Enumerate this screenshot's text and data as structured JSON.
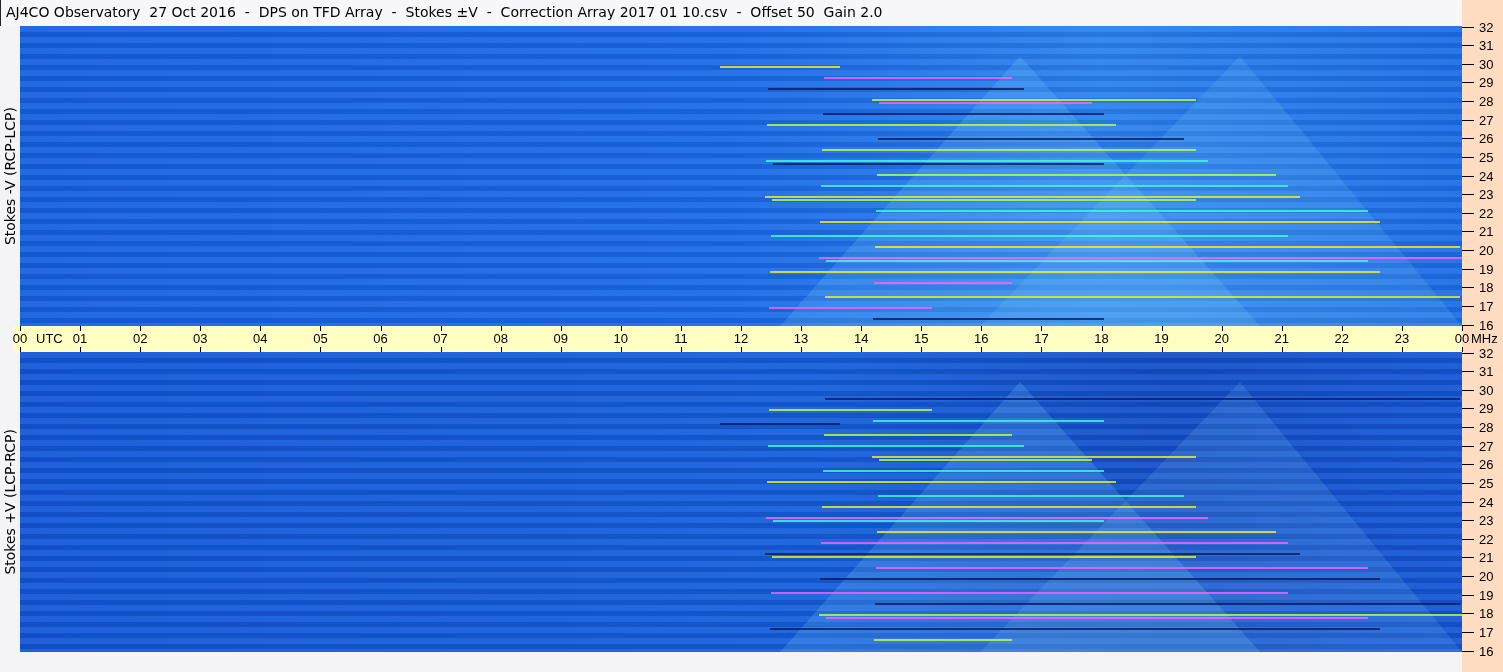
{
  "title": "AJ4CO Observatory  27 Oct 2016  -  DPS on TFD Array  -  Stokes ±V  -  Correction Array 2017 01 10.csv  -  Offset 50  Gain 2.0",
  "panels": [
    {
      "label": "Stokes -V (RCP-LCP)",
      "frequency_ticks": [
        "32",
        "31",
        "30",
        "29",
        "28",
        "27",
        "26",
        "25",
        "24",
        "23",
        "22",
        "21",
        "20",
        "19",
        "18",
        "17",
        "16"
      ]
    },
    {
      "label": "Stokes +V (LCP-RCP)",
      "frequency_ticks": [
        "32",
        "31",
        "30",
        "29",
        "28",
        "27",
        "26",
        "25",
        "24",
        "23",
        "22",
        "21",
        "20",
        "19",
        "18",
        "17",
        "16"
      ]
    }
  ],
  "time_axis": {
    "ticks": [
      "00",
      "01",
      "02",
      "03",
      "04",
      "05",
      "06",
      "07",
      "08",
      "09",
      "10",
      "11",
      "12",
      "13",
      "14",
      "15",
      "16",
      "17",
      "18",
      "19",
      "20",
      "21",
      "22",
      "23",
      "00"
    ],
    "unit": "UTC",
    "frequency_unit": "MHz"
  }
}
